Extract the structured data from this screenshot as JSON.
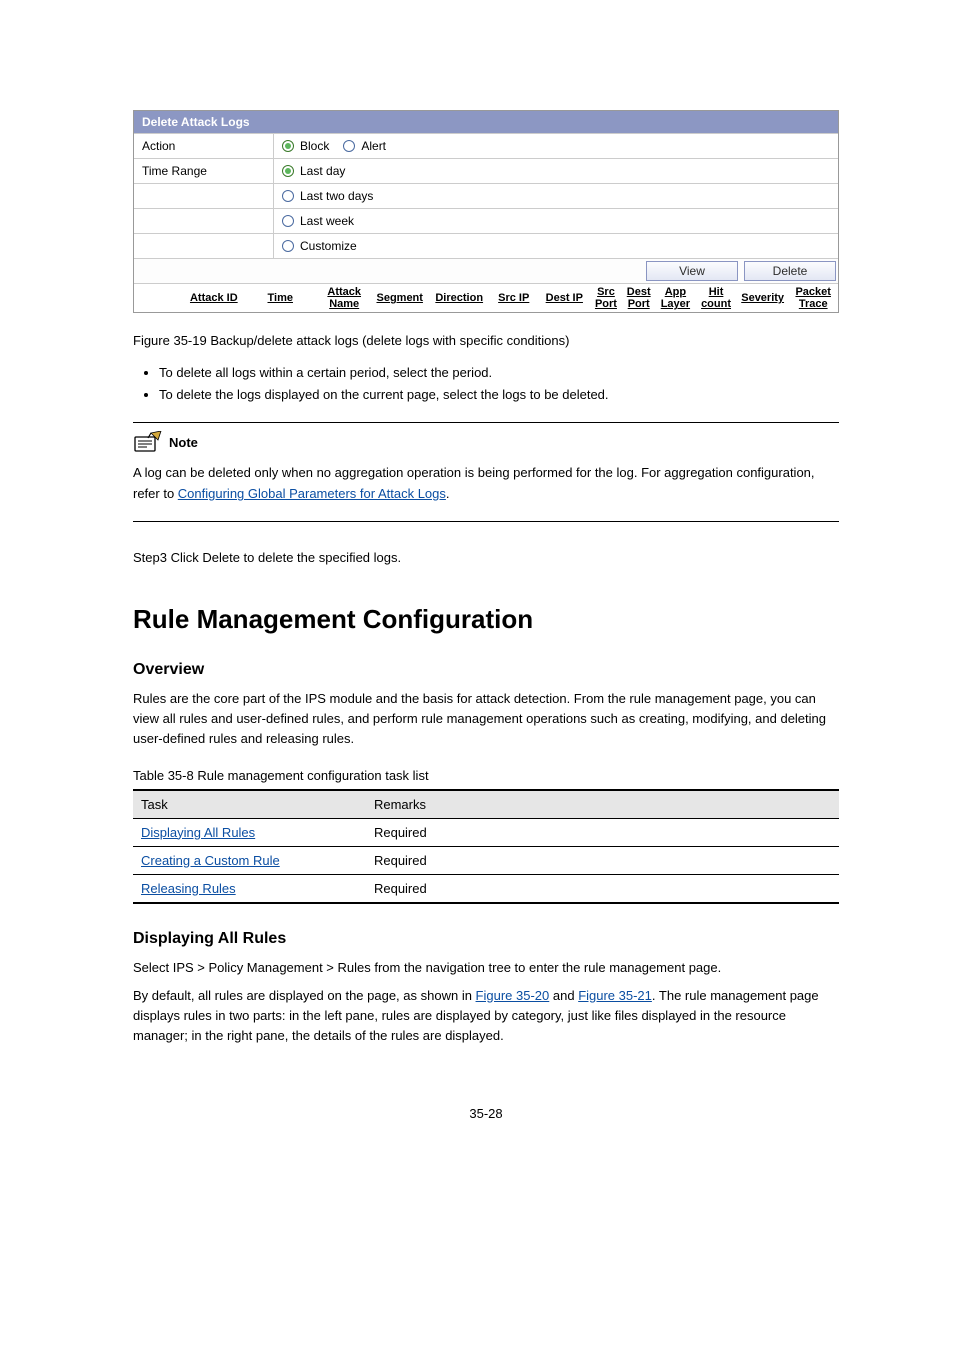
{
  "panel": {
    "title": "Delete Attack Logs",
    "action_label": "Action",
    "block_label": "Block",
    "alert_label": "Alert",
    "time_label": "Time Range",
    "opts": {
      "last_day": "Last day",
      "last_two": "Last two days",
      "last_week": "Last week",
      "custom": "Customize"
    },
    "view_btn": "View",
    "delete_btn": "Delete",
    "cols": {
      "attack_id": "Attack ID",
      "time": "Time",
      "attack_name": "Attack Name",
      "segment": "Segment",
      "direction": "Direction",
      "src_ip": "Src IP",
      "dest_ip": "Dest IP",
      "src_port": "Src Port",
      "dest_port": "Dest Port",
      "app_layer": "App Layer",
      "hit_count": "Hit count",
      "severity": "Severity",
      "packet_trace": "Packet Trace"
    }
  },
  "fig_caption": "Figure 35-19 Backup/delete attack logs (delete logs with specific conditions)",
  "bullets": {
    "b1": "To delete all logs within a certain period, select the period.",
    "b2": "To delete the logs displayed on the current page, select the logs to be deleted."
  },
  "note": {
    "label": "Note",
    "body_pre": "A log can be deleted only when no aggregation operation is being performed for the log. For aggregation configuration, refer to ",
    "link": "Configuring Global Parameters for Attack Logs",
    "body_post": "."
  },
  "step3": "Step3 Click Delete to delete the specified logs.",
  "h1": "Rule Management Configuration",
  "h2_overview": "Overview",
  "overview_para": "Rules are the core part of the IPS module and the basis for attack detection. From the rule management page, you can view all rules and user-defined rules, and perform rule management operations such as creating, modifying, and deleting user-defined rules and releasing rules.",
  "tbl_caption": "Table 35-8 Rule management configuration task list",
  "tasks_header": {
    "task": "Task",
    "remarks": "Remarks"
  },
  "tasks": [
    {
      "task": "Displaying All Rules",
      "remarks": "Required"
    },
    {
      "task": "Creating a Custom Rule",
      "remarks": "Required"
    },
    {
      "task": "Releasing Rules",
      "remarks": "Required"
    }
  ],
  "h2_display": "Displaying All Rules",
  "display_p1": "Select IPS > Policy Management > Rules from the navigation tree to enter the rule management page.",
  "display_p2_pre": "By default, all rules are displayed on the page, as shown in ",
  "display_p2_link1": "Figure 35-20",
  "display_p2_mid": " and ",
  "display_p2_link2": "Figure 35-21",
  "display_p2_post": ". The rule management page displays rules in two parts: in the left pane, rules are displayed by category, just like files displayed in the resource manager; in the right pane, the details of the rules are displayed.",
  "page_num": "35-28"
}
